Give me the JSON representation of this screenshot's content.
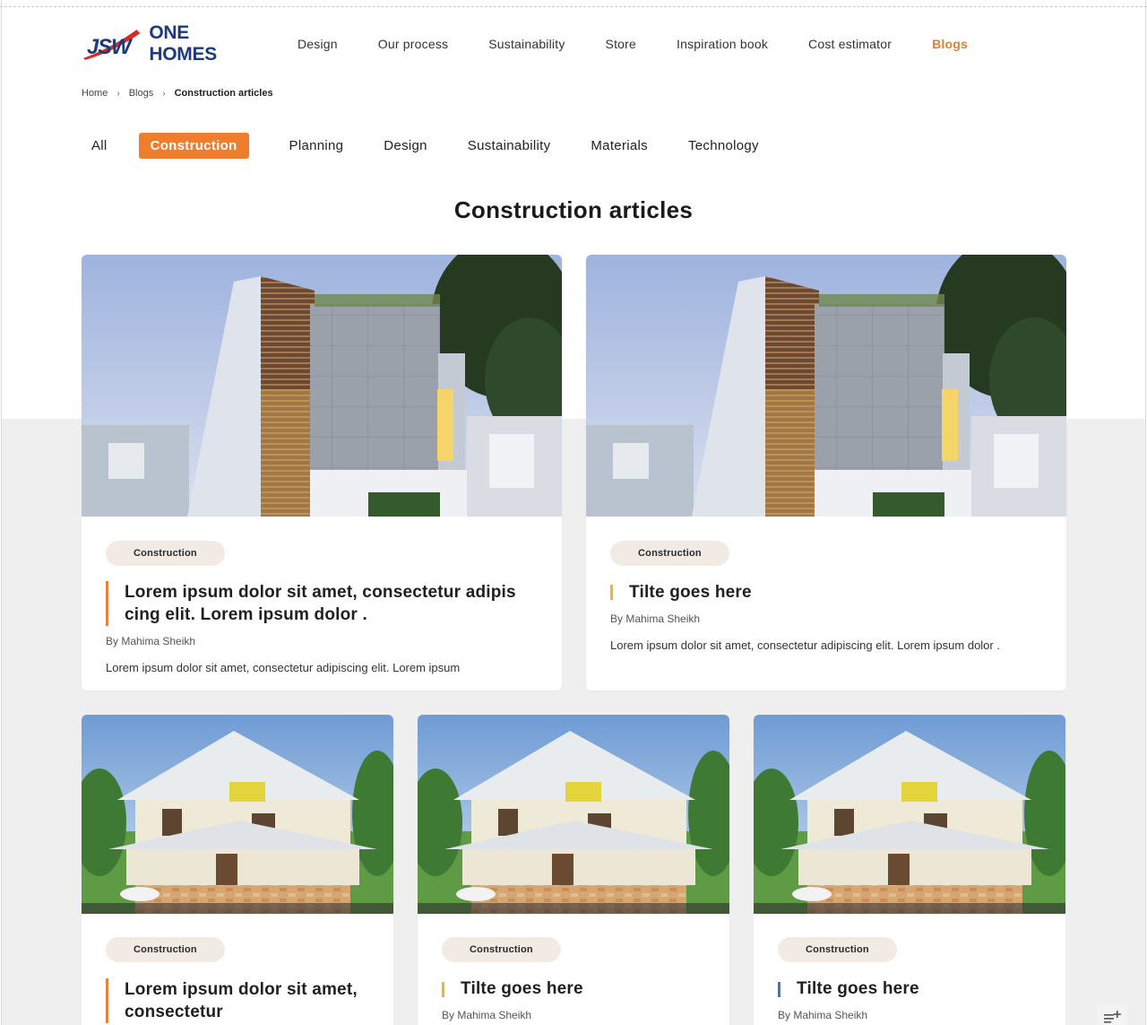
{
  "brand": {
    "logo_text": "ONE HOMES",
    "logo_mark": "JSW"
  },
  "nav": {
    "items": [
      {
        "label": "Design"
      },
      {
        "label": "Our process"
      },
      {
        "label": "Sustainability"
      },
      {
        "label": "Store"
      },
      {
        "label": "Inspiration book"
      },
      {
        "label": "Cost estimator"
      },
      {
        "label": "Blogs"
      }
    ],
    "active": "Blogs"
  },
  "breadcrumb": {
    "items": [
      "Home",
      "Blogs",
      "Construction articles"
    ],
    "separator_icon": "chevron-right-icon"
  },
  "tabs": {
    "items": [
      "All",
      "Construction",
      "Planning",
      "Design",
      "Sustainability",
      "Materials",
      "Technology"
    ],
    "active": "Construction"
  },
  "page": {
    "title": "Construction articles"
  },
  "colors": {
    "accent": "#ee7d2e",
    "bar_orange": "#e8803a",
    "bar_yellow": "#f0b43a",
    "bar_blue": "#5a6f9a",
    "badge_bg": "#f1ebe3",
    "band_grey": "#efefef"
  },
  "articles": [
    {
      "image": "modern-house-photo",
      "category": "Construction",
      "title": "Lorem ipsum dolor sit amet, consectetur adipis cing elit. Lorem ipsum dolor .",
      "author": "By Mahima Sheikh",
      "excerpt": "Lorem ipsum dolor sit amet, consectetur adipiscing elit. Lorem ipsum",
      "bar_color": "#e8803a"
    },
    {
      "image": "modern-house-photo",
      "category": "Construction",
      "title": "Tilte goes here",
      "author": "By Mahima Sheikh",
      "excerpt": "Lorem ipsum dolor sit amet, consectetur adipiscing elit. Lorem ipsum dolor .",
      "bar_color": "#f0b43a"
    },
    {
      "image": "villa-render-photo",
      "category": "Construction",
      "title": "Lorem ipsum dolor sit amet, consectetur",
      "author": "",
      "excerpt": "",
      "bar_color": "#e8803a"
    },
    {
      "image": "villa-render-photo",
      "category": "Construction",
      "title": "Tilte goes here",
      "author": "By Mahima Sheikh",
      "excerpt": "",
      "bar_color": "#f0b43a"
    },
    {
      "image": "villa-render-photo",
      "category": "Construction",
      "title": "Tilte goes here",
      "author": "By Mahima Sheikh",
      "excerpt": "",
      "bar_color": "#5a6f9a"
    }
  ],
  "floating_action": {
    "icon": "add-list-icon"
  }
}
